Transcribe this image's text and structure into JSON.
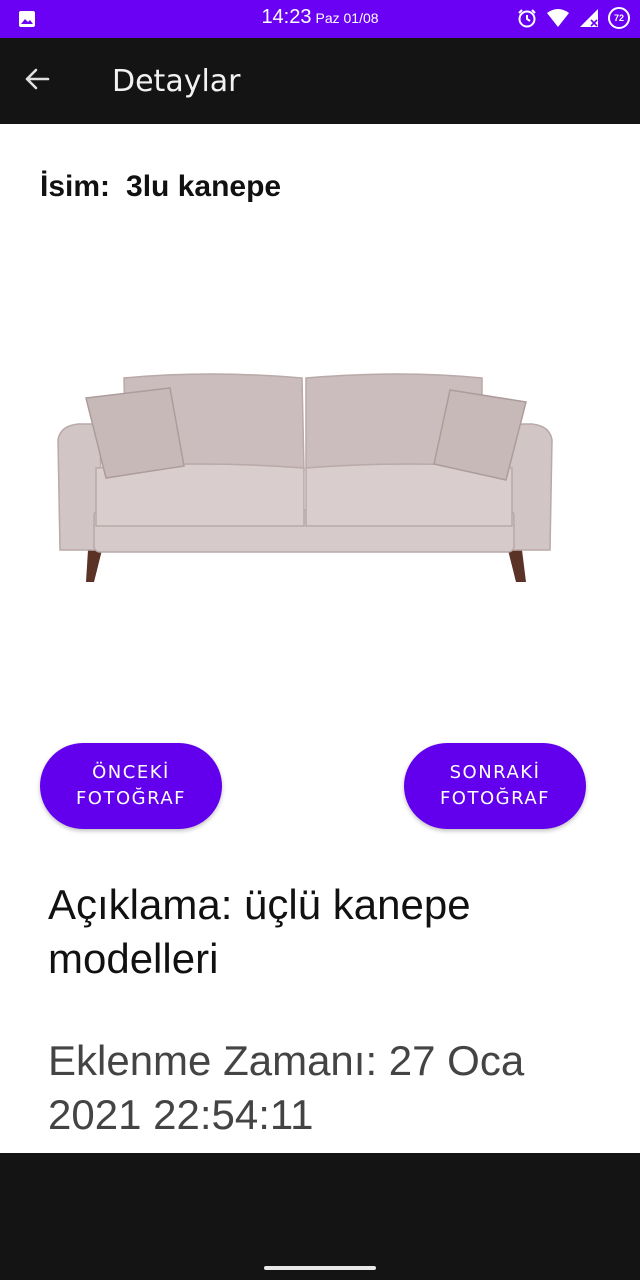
{
  "status_bar": {
    "time": "14:23",
    "date": "Paz 01/08",
    "battery": "72",
    "color": "#6a00f4",
    "icons": [
      "gallery-icon",
      "alarm-icon",
      "wifi-icon",
      "signal-icon",
      "battery-icon"
    ]
  },
  "app_bar": {
    "title": "Detaylar",
    "back_icon": "arrow-left-icon"
  },
  "product": {
    "name_label": "İsim:",
    "name_value": "3lu kanepe",
    "image": "sofa-image",
    "description": "Açıklama: üçlü kanepe modelleri",
    "added_time": "Eklenme Zamanı: 27 Oca 2021 22:54:11"
  },
  "buttons": {
    "prev_line1": "ÖNCEKİ",
    "prev_line2": "FOTOĞRAF",
    "next_line1": "SONRAKİ",
    "next_line2": "FOTOĞRAF",
    "accent": "#6200ee"
  }
}
